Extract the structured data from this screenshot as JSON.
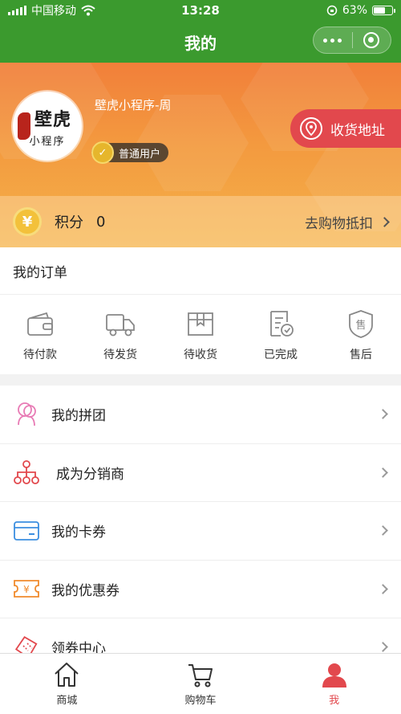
{
  "status_bar": {
    "carrier": "中国移动",
    "time": "13:28",
    "battery": "63%",
    "battery_level": 0.63
  },
  "nav": {
    "title": "我的"
  },
  "profile": {
    "avatar_text_big": "壁虎",
    "avatar_text_small": "小程序",
    "username": "壁虎小程序-周",
    "level": "普通用户",
    "address_button": "收货地址"
  },
  "points": {
    "label": "积分",
    "value": "0",
    "action": "去购物抵扣"
  },
  "orders": {
    "title": "我的订单",
    "items": [
      {
        "label": "待付款",
        "icon": "wallet-icon"
      },
      {
        "label": "待发货",
        "icon": "truck-icon"
      },
      {
        "label": "待收货",
        "icon": "package-icon"
      },
      {
        "label": "已完成",
        "icon": "completed-doc-icon"
      },
      {
        "label": "售后",
        "icon": "after-sale-shield-icon"
      }
    ]
  },
  "menu": {
    "items": [
      {
        "label": "我的拼团",
        "icon": "group-buy-icon"
      },
      {
        "label": "成为分销商",
        "icon": "distributor-network-icon"
      },
      {
        "label": "我的卡券",
        "icon": "card-icon"
      },
      {
        "label": "我的优惠券",
        "icon": "coupon-icon"
      },
      {
        "label": "领券中心",
        "icon": "coupon-center-icon"
      }
    ]
  },
  "tabbar": {
    "items": [
      {
        "label": "商城",
        "icon": "home-icon"
      },
      {
        "label": "购物车",
        "icon": "cart-icon"
      },
      {
        "label": "我",
        "icon": "user-icon"
      }
    ]
  },
  "colors": {
    "nav_green": "#3b9a2e",
    "accent_red": "#e2484d",
    "header_orange": "#f39a3f"
  }
}
